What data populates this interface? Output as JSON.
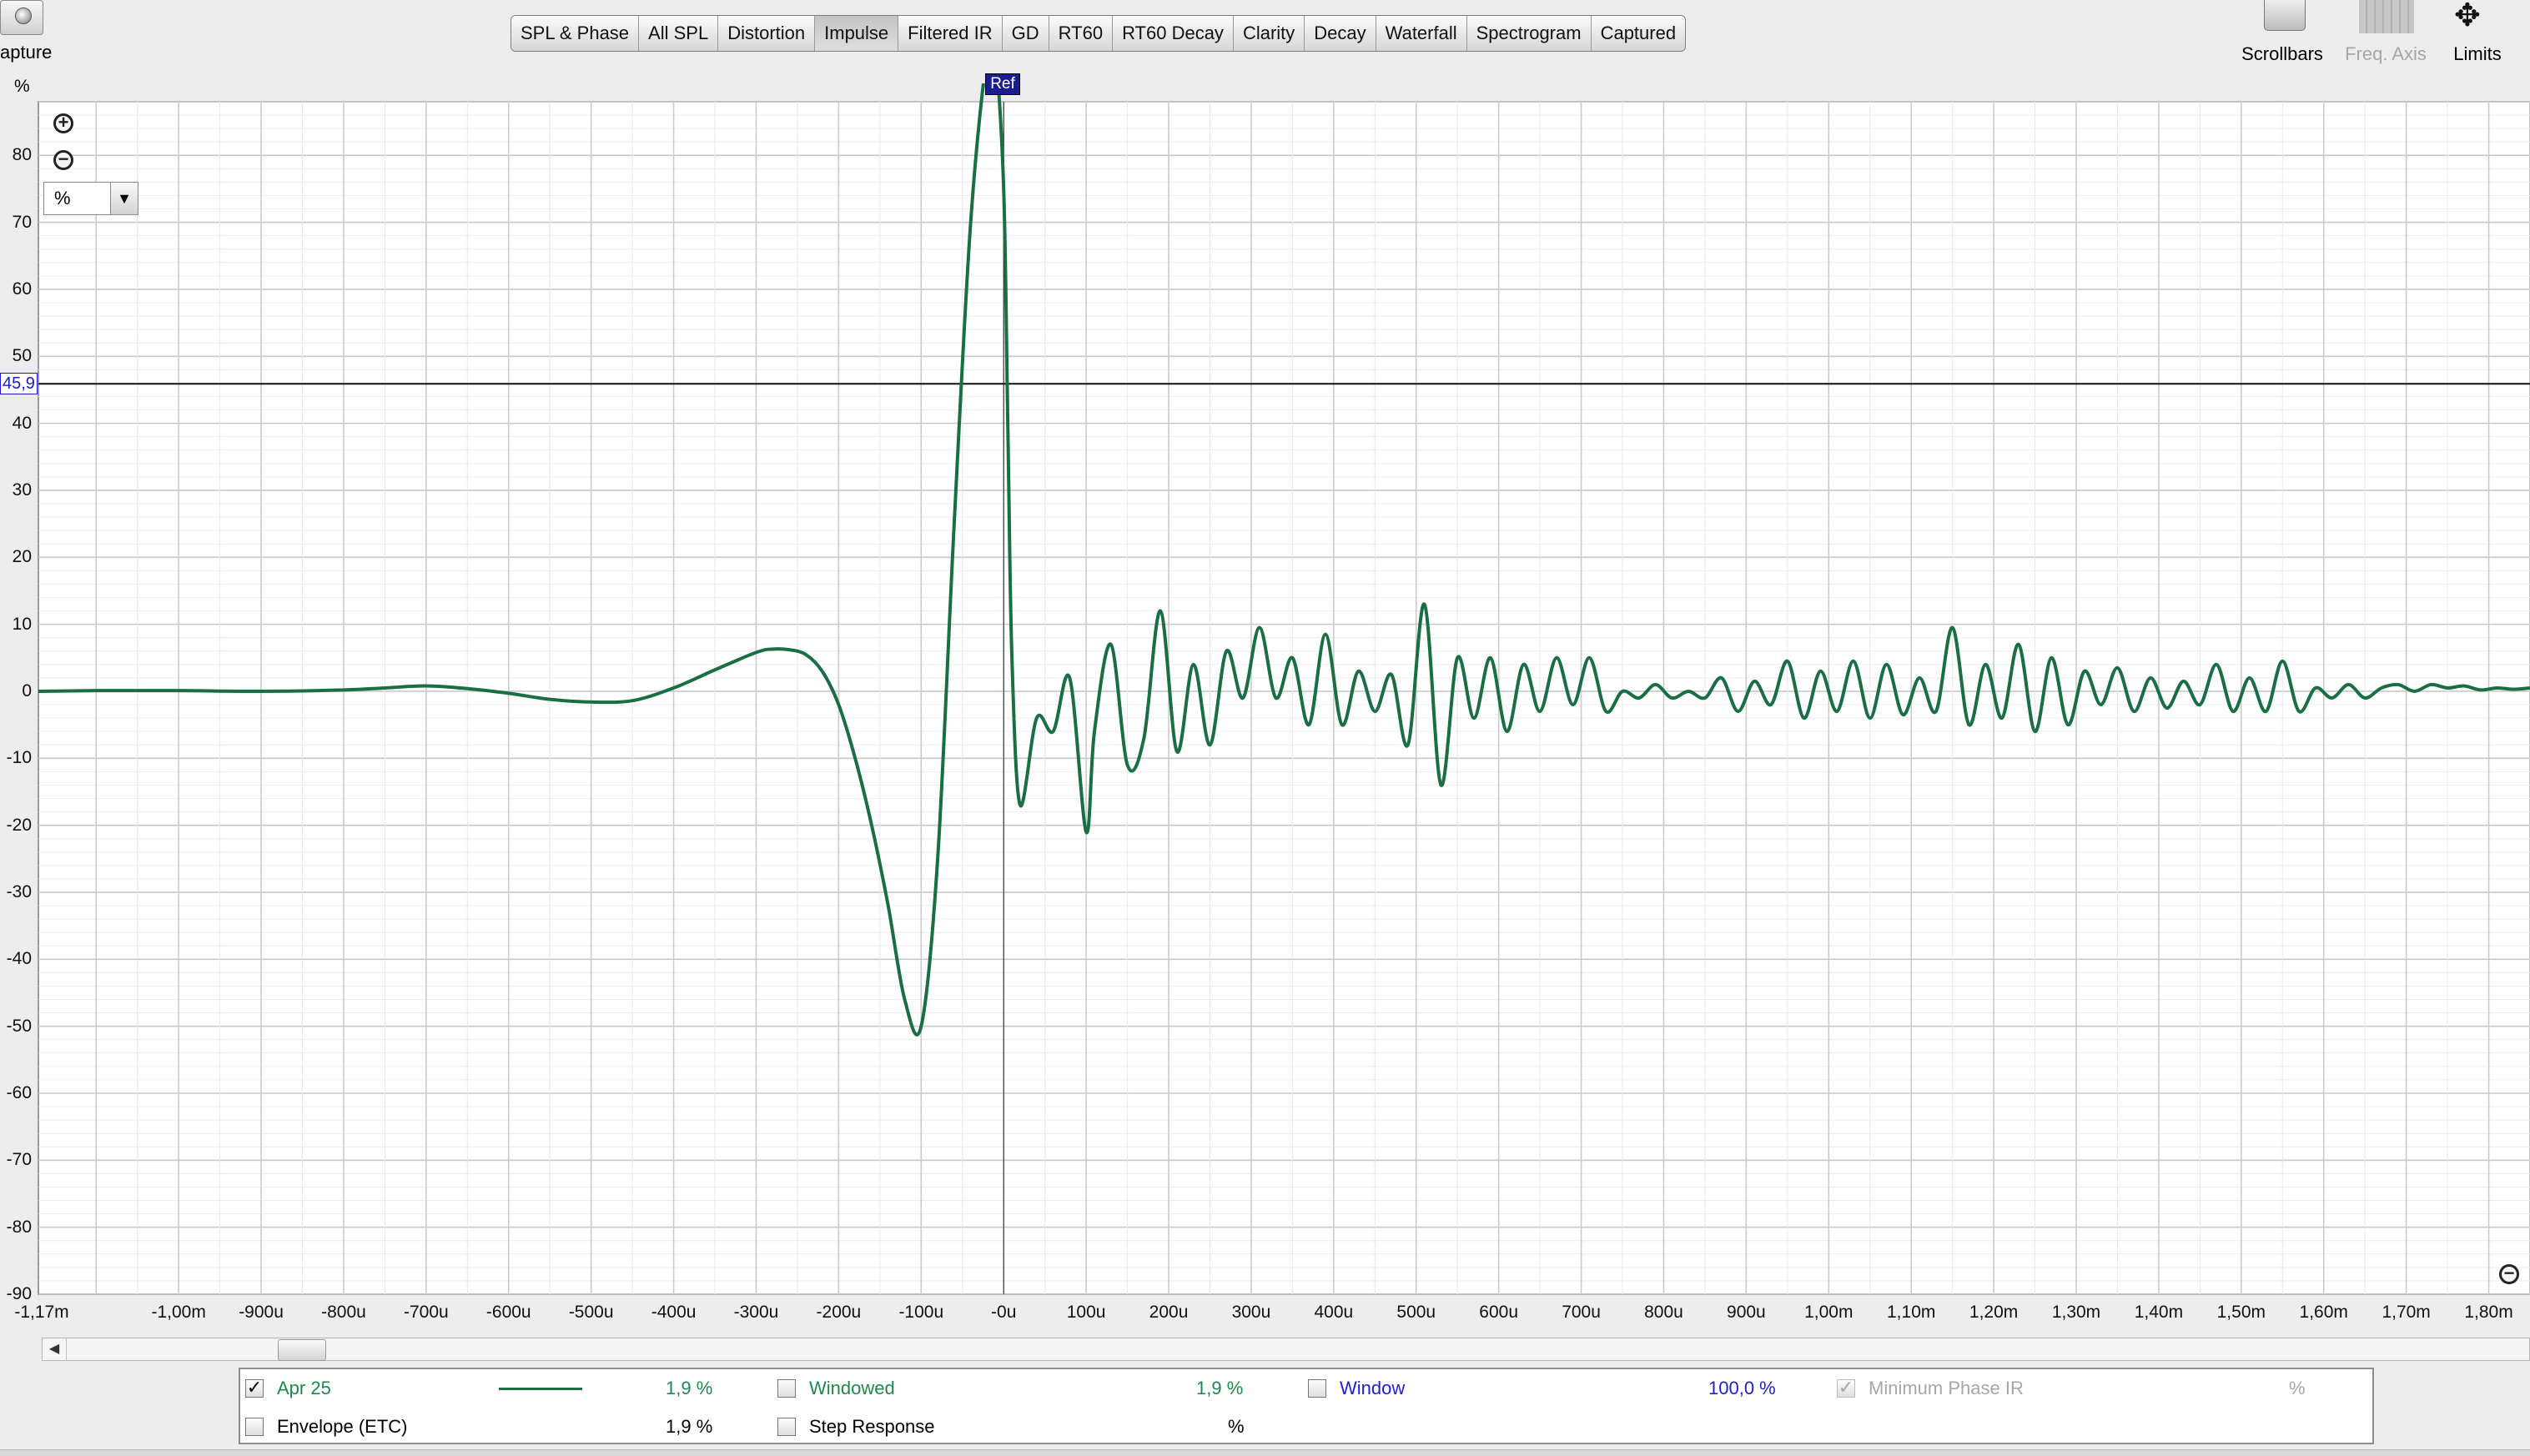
{
  "capture": {
    "label": "apture"
  },
  "tabs": [
    {
      "label": "SPL & Phase",
      "active": false
    },
    {
      "label": "All SPL",
      "active": false
    },
    {
      "label": "Distortion",
      "active": false
    },
    {
      "label": "Impulse",
      "active": true
    },
    {
      "label": "Filtered IR",
      "active": false
    },
    {
      "label": "GD",
      "active": false
    },
    {
      "label": "RT60",
      "active": false
    },
    {
      "label": "RT60 Decay",
      "active": false
    },
    {
      "label": "Clarity",
      "active": false
    },
    {
      "label": "Decay",
      "active": false
    },
    {
      "label": "Waterfall",
      "active": false
    },
    {
      "label": "Spectrogram",
      "active": false
    },
    {
      "label": "Captured",
      "active": false
    }
  ],
  "tools": {
    "scrollbars": "Scrollbars",
    "freq_axis": "Freq. Axis",
    "limits": "Limits"
  },
  "plot": {
    "y_unit": "%",
    "cursor_value": "45,9",
    "ref_marker": "Ref",
    "unit_select": "%",
    "y_ticks": [
      "80",
      "70",
      "60",
      "50",
      "40",
      "30",
      "20",
      "10",
      "0",
      "-10",
      "-20",
      "-30",
      "-40",
      "-50",
      "-60",
      "-70",
      "-80",
      "-90"
    ],
    "x_ticks": [
      "-1,17m",
      "-1,00m",
      "-900u",
      "-800u",
      "-700u",
      "-600u",
      "-500u",
      "-400u",
      "-300u",
      "-200u",
      "-100u",
      "-0u",
      "100u",
      "200u",
      "300u",
      "400u",
      "500u",
      "600u",
      "700u",
      "800u",
      "900u",
      "1,00m",
      "1,10m",
      "1,20m",
      "1,30m",
      "1,40m",
      "1,50m",
      "1,60m",
      "1,70m",
      "1,80m"
    ],
    "trace_color": "#1a6e44"
  },
  "chart_data": {
    "type": "line",
    "title": "",
    "xlabel": "",
    "ylabel": "%",
    "x_unit": "s",
    "xlim": [
      -0.00117,
      0.00185
    ],
    "ylim": [
      -90,
      88
    ],
    "cursor_y": 45.9,
    "grid": true,
    "series": [
      {
        "name": "Apr 25",
        "x": [
          -0.00117,
          -0.0011,
          -0.001,
          -0.0009,
          -0.0008,
          -0.00075,
          -0.0007,
          -0.00065,
          -0.0006,
          -0.00055,
          -0.0005,
          -0.00045,
          -0.0004,
          -0.00035,
          -0.0003,
          -0.00028,
          -0.00026,
          -0.00024,
          -0.00022,
          -0.0002,
          -0.00018,
          -0.00016,
          -0.00014,
          -0.00012,
          -0.0001,
          -8e-05,
          -6e-05,
          -4e-05,
          -2e-05,
          -1e-05,
          0.0,
          5e-06,
          1e-05,
          2e-05,
          4e-05,
          6e-05,
          8e-05,
          0.0001,
          0.00011,
          0.00013,
          0.00015,
          0.00017,
          0.00019,
          0.00021,
          0.00023,
          0.00025,
          0.00027,
          0.00029,
          0.00031,
          0.00033,
          0.00035,
          0.00037,
          0.00039,
          0.00041,
          0.00043,
          0.00045,
          0.00047,
          0.00049,
          0.00051,
          0.00053,
          0.00055,
          0.00057,
          0.00059,
          0.00061,
          0.00063,
          0.00065,
          0.00067,
          0.00069,
          0.00071,
          0.00073,
          0.00075,
          0.00077,
          0.00079,
          0.00081,
          0.00083,
          0.00085,
          0.00087,
          0.00089,
          0.00091,
          0.00093,
          0.00095,
          0.00097,
          0.00099,
          0.00101,
          0.00103,
          0.00105,
          0.00107,
          0.00109,
          0.00111,
          0.00113,
          0.00115,
          0.00117,
          0.00119,
          0.00121,
          0.00123,
          0.00125,
          0.00127,
          0.00129,
          0.00131,
          0.00133,
          0.00135,
          0.00137,
          0.00139,
          0.00141,
          0.00143,
          0.00145,
          0.00147,
          0.00149,
          0.00151,
          0.00153,
          0.00155,
          0.00157,
          0.00159,
          0.00161,
          0.00163,
          0.00165,
          0.00167,
          0.00169,
          0.00171,
          0.00173,
          0.00175,
          0.00177,
          0.00179,
          0.00181,
          0.00183,
          0.00185
        ],
        "y": [
          0,
          0.1,
          0.1,
          0,
          0.2,
          0.5,
          0.8,
          0.4,
          -0.3,
          -1.2,
          -1.6,
          -1.4,
          0.5,
          3.2,
          5.8,
          6.3,
          6.2,
          5.5,
          3.0,
          -2.0,
          -10.0,
          -20.0,
          -32.0,
          -46.0,
          -50.0,
          -25.0,
          25.0,
          70.0,
          95.0,
          95.0,
          75.0,
          40.0,
          5.0,
          -17.0,
          -4.0,
          -6.0,
          2.0,
          -21.0,
          -6.0,
          7.0,
          -11.0,
          -7.0,
          12.0,
          -9.0,
          4.0,
          -8.0,
          6.0,
          -1.0,
          9.5,
          -1.0,
          5.0,
          -5.0,
          8.5,
          -5.0,
          3.0,
          -3.0,
          2.5,
          -8.0,
          13.0,
          -14.0,
          5.0,
          -4.0,
          5.0,
          -6.0,
          4.0,
          -3.0,
          5.0,
          -2.0,
          5.0,
          -3.0,
          0,
          -1.0,
          1.0,
          -1.0,
          0,
          -1.0,
          2.0,
          -3.0,
          1.5,
          -2.0,
          4.5,
          -4.0,
          3.0,
          -3.0,
          4.5,
          -4.0,
          4.0,
          -3.5,
          2.0,
          -3.0,
          9.5,
          -5.0,
          4.0,
          -4.0,
          7.0,
          -6.0,
          5.0,
          -5.0,
          3.0,
          -2.0,
          3.5,
          -3.0,
          2.0,
          -2.5,
          1.5,
          -2.0,
          4.0,
          -3.0,
          2.0,
          -3.0,
          4.5,
          -3.0,
          0.5,
          -1.0,
          1.0,
          -1.0,
          0.5,
          1.0,
          0,
          1.0,
          0.5,
          0.8,
          0.2,
          0.5,
          0.3,
          0.5
        ]
      }
    ]
  },
  "scrollbar": {
    "left_arrow": "◀"
  },
  "legend": {
    "row1": {
      "trace": {
        "checked": true,
        "label": "Apr 25",
        "value": "1,9 %"
      },
      "windowed": {
        "checked": false,
        "label": "Windowed",
        "value": "1,9 %"
      },
      "window": {
        "checked": false,
        "label": "Window",
        "value": "100,0 %"
      },
      "min_phase": {
        "checked": true,
        "label": "Minimum Phase IR",
        "value": "%"
      }
    },
    "row2": {
      "envelope": {
        "checked": false,
        "label": "Envelope (ETC)",
        "value": "1,9 %"
      },
      "step": {
        "checked": false,
        "label": "Step Response",
        "value": "%"
      }
    }
  }
}
